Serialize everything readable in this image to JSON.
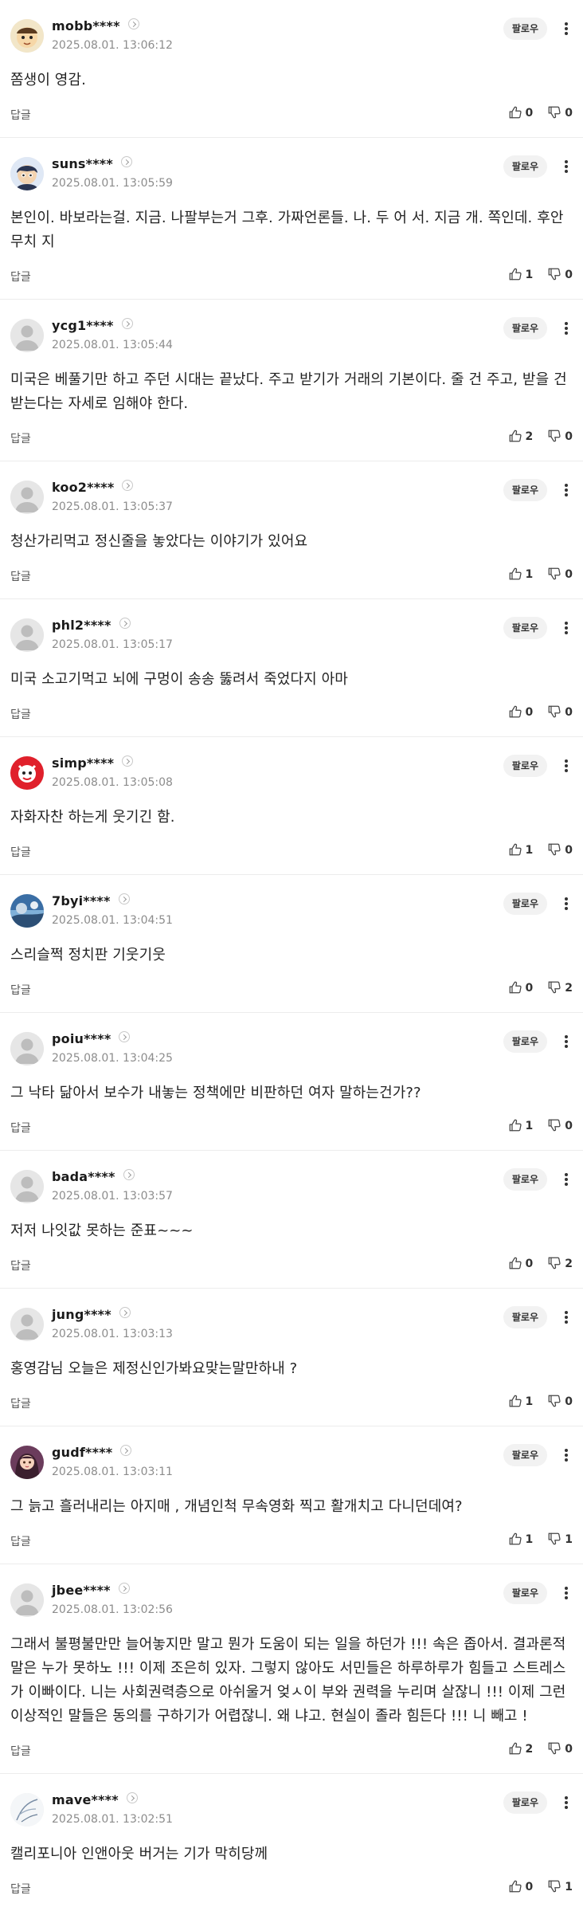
{
  "labels": {
    "follow": "팔로우",
    "reply": "답글"
  },
  "comments": [
    {
      "user": "mobb****",
      "date": "2025.08.01. 13:06:12",
      "text": "쫌생이 영감.",
      "likes": "0",
      "dislikes": "0",
      "avatar": "character"
    },
    {
      "user": "suns****",
      "date": "2025.08.01. 13:05:59",
      "text": "본인이. 바보라는걸. 지금. 나팔부는거 그후. 가짜언론들. 나. 두 어 서. 지금 개. 쪽인데. 후안무치 지",
      "likes": "1",
      "dislikes": "0",
      "avatar": "character-2"
    },
    {
      "user": "ycg1****",
      "date": "2025.08.01. 13:05:44",
      "text": "미국은 베풀기만 하고 주던 시대는 끝났다. 주고 받기가 거래의 기본이다. 줄 건 주고, 받을 건 받는다는 자세로 임해야 한다.",
      "likes": "2",
      "dislikes": "0",
      "avatar": "default"
    },
    {
      "user": "koo2****",
      "date": "2025.08.01. 13:05:37",
      "text": "청산가리먹고 정신줄을 놓았다는 이야기가 있어요",
      "likes": "1",
      "dislikes": "0",
      "avatar": "default"
    },
    {
      "user": "phl2****",
      "date": "2025.08.01. 13:05:17",
      "text": "미국 소고기먹고 뇌에 구멍이 송송 뚫려서 죽었다지 아마",
      "likes": "0",
      "dislikes": "0",
      "avatar": "default"
    },
    {
      "user": "simp****",
      "date": "2025.08.01. 13:05:08",
      "text": "자화자찬 하는게 웃기긴 함.",
      "likes": "1",
      "dislikes": "0",
      "avatar": "red-character"
    },
    {
      "user": "7byi****",
      "date": "2025.08.01. 13:04:51",
      "text": "스리슬쩍 정치판 기웃기웃",
      "likes": "0",
      "dislikes": "2",
      "avatar": "photo"
    },
    {
      "user": "poiu****",
      "date": "2025.08.01. 13:04:25",
      "text": "그 낙타 닮아서 보수가 내놓는 정책에만 비판하던 여자 말하는건가??",
      "likes": "1",
      "dislikes": "0",
      "avatar": "default"
    },
    {
      "user": "bada****",
      "date": "2025.08.01. 13:03:57",
      "text": "저저 나잇값 못하는 준표~~~",
      "likes": "0",
      "dislikes": "2",
      "avatar": "default"
    },
    {
      "user": "jung****",
      "date": "2025.08.01. 13:03:13",
      "text": "홍영감님 오늘은 제정신인가봐요맞는말만하내 ?",
      "likes": "1",
      "dislikes": "0",
      "avatar": "default"
    },
    {
      "user": "gudf****",
      "date": "2025.08.01. 13:03:11",
      "text": "그 늙고 흘러내리는 아지매 , 개념인척 무속영화 찍고 활개치고 다니던데여?",
      "likes": "1",
      "dislikes": "1",
      "avatar": "girl"
    },
    {
      "user": "jbee****",
      "date": "2025.08.01. 13:02:56",
      "text": "그래서 불평불만만 늘어놓지만 말고 뭔가 도움이 되는 일을 하던가 !!! 속은 좁아서. 결과론적 말은 누가 못하노 !!! 이제 조은히 있자. 그렇지 않아도 서민들은 하루하루가 힘들고 스트레스가 이빠이다. 니는 사회권력층으로 아쉬울거 엊ㅅ이 부와 권력을 누리며 살잖니 !!! 이제 그런 이상적인 말들은 동의를 구하기가 어렵잖니. 왜 냐고. 현실이 졸라 힘든다 !!! 니 빼고 !",
      "likes": "2",
      "dislikes": "0",
      "avatar": "default"
    },
    {
      "user": "mave****",
      "date": "2025.08.01. 13:02:51",
      "text": "캘리포니아 인앤아웃 버거는 기가 막히당께",
      "likes": "0",
      "dislikes": "1",
      "avatar": "sketch"
    }
  ]
}
